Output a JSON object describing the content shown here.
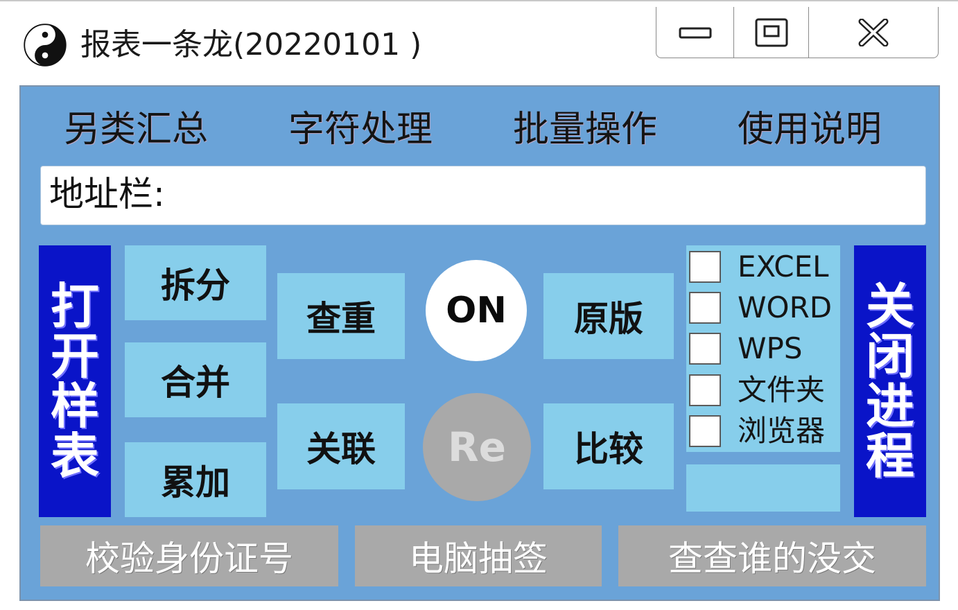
{
  "window": {
    "title": "报表一条龙(20220101 )",
    "app_icon": "yin-yang-icon",
    "controls": {
      "minimize_icon": "minimize-icon",
      "maximize_icon": "maximize-icon",
      "close_icon": "close-icon"
    }
  },
  "menu": {
    "items": [
      {
        "label": "另类汇总"
      },
      {
        "label": "字符处理"
      },
      {
        "label": "批量操作"
      },
      {
        "label": "使用说明"
      }
    ]
  },
  "address": {
    "label": "地址栏:",
    "value": ""
  },
  "left_button": {
    "label": "打开样表"
  },
  "right_button": {
    "label": "关闭进程"
  },
  "actions": {
    "split": "拆分",
    "merge": "合并",
    "accumulate": "累加",
    "dedupe": "查重",
    "relate": "关联",
    "original": "原版",
    "compare": "比较",
    "on": "ON",
    "re": "Re"
  },
  "targets": [
    {
      "label": "EXCEL",
      "checked": false
    },
    {
      "label": "WORD",
      "checked": false
    },
    {
      "label": "WPS",
      "checked": false
    },
    {
      "label": "文件夹",
      "checked": false
    },
    {
      "label": "浏览器",
      "checked": false
    }
  ],
  "bottom_buttons": {
    "id_check": "校验身份证号",
    "draw_lots": "电脑抽签",
    "missing_check": "查查谁的没交"
  },
  "colors": {
    "panel": "#6aa3d8",
    "light_button": "#87ceeb",
    "blue_button": "#0a14c8",
    "gray_button": "#a9a9a9"
  }
}
